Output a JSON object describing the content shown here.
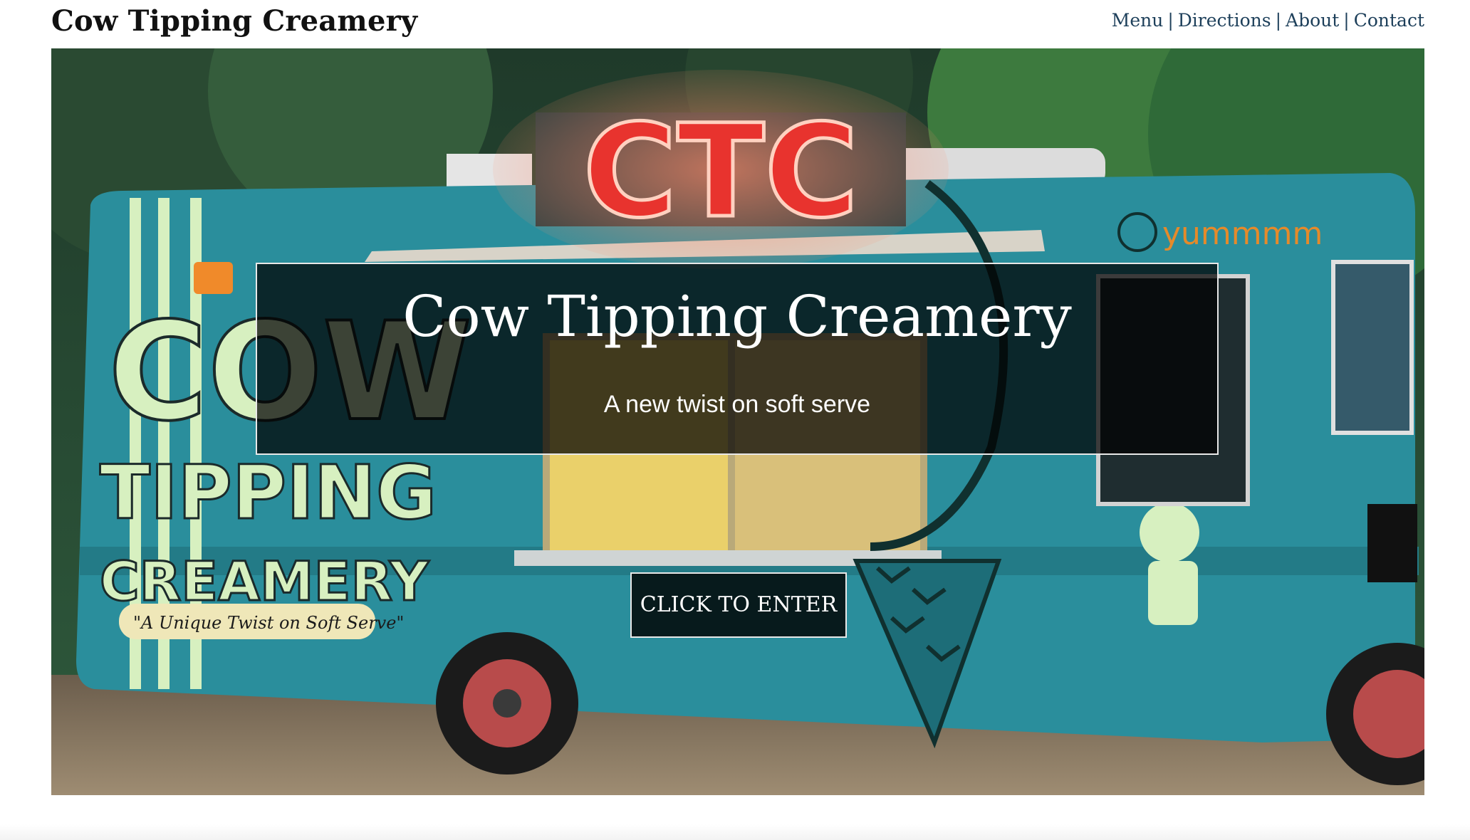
{
  "header": {
    "site_title": "Cow Tipping Creamery",
    "nav": {
      "menu": "Menu",
      "directions": "Directions",
      "about": "About",
      "contact": "Contact",
      "separator": "|"
    }
  },
  "hero": {
    "image_label": "Cow Tipping Creamery food truck",
    "title": "Cow Tipping Creamery",
    "subtitle": "A new twist on soft serve",
    "cta_label": "CLICK TO ENTER",
    "truck_sign": "CTC",
    "truck_brand_lines": [
      "COW",
      "TIPPING",
      "CREAMERY"
    ],
    "truck_slogan": "\"A Unique Twist on Soft Serve\"",
    "truck_tagline": "yummmm"
  },
  "colors": {
    "truck_teal": "#2a8e9c",
    "neon_red": "#e8332e",
    "brand_cream": "#d7f0c0",
    "nav_link": "#1d3f5a"
  }
}
